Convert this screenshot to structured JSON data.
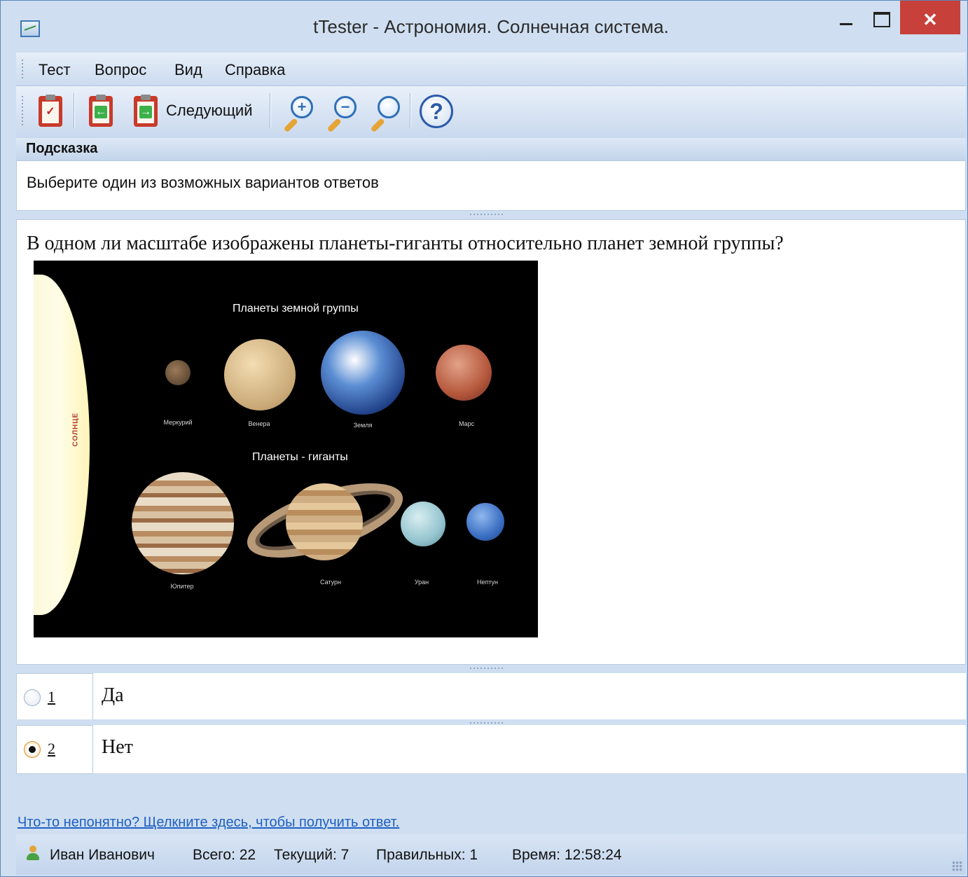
{
  "window": {
    "title": "tTester - Астрономия. Солнечная система.",
    "close_glyph": "✕"
  },
  "menu": {
    "items": [
      "Тест",
      "Вопрос",
      "Вид",
      "Справка"
    ]
  },
  "toolbar": {
    "next_label": "Следующий",
    "zoom_in_glyph": "+",
    "zoom_out_glyph": "−",
    "help_glyph": "?"
  },
  "hint": {
    "header": "Подсказка",
    "text": "Выберите один из возможных вариантов ответов"
  },
  "question": {
    "text": "В одном ли масштабе  изображены планеты-гиганты относительно планет земной группы?",
    "image": {
      "sun_label": "СОЛНЦЕ",
      "terrestrial_heading": "Планеты земной группы",
      "giants_heading": "Планеты - гиганты",
      "planets": [
        "Меркурий",
        "Венера",
        "Земля",
        "Марс",
        "Юпитер",
        "Сатурн",
        "Уран",
        "Нептун"
      ]
    }
  },
  "answers": [
    {
      "number": "1",
      "text": "Да",
      "selected": false
    },
    {
      "number": "2",
      "text": "Нет",
      "selected": true
    }
  ],
  "help_link": "Что-то непонятно? Щелкните здесь, чтобы получить ответ.",
  "status": {
    "user": "Иван Иванович",
    "total": "Всего: 22",
    "current": "Текущий: 7",
    "correct": "Правильных: 1",
    "time": "Время: 12:58:24"
  }
}
